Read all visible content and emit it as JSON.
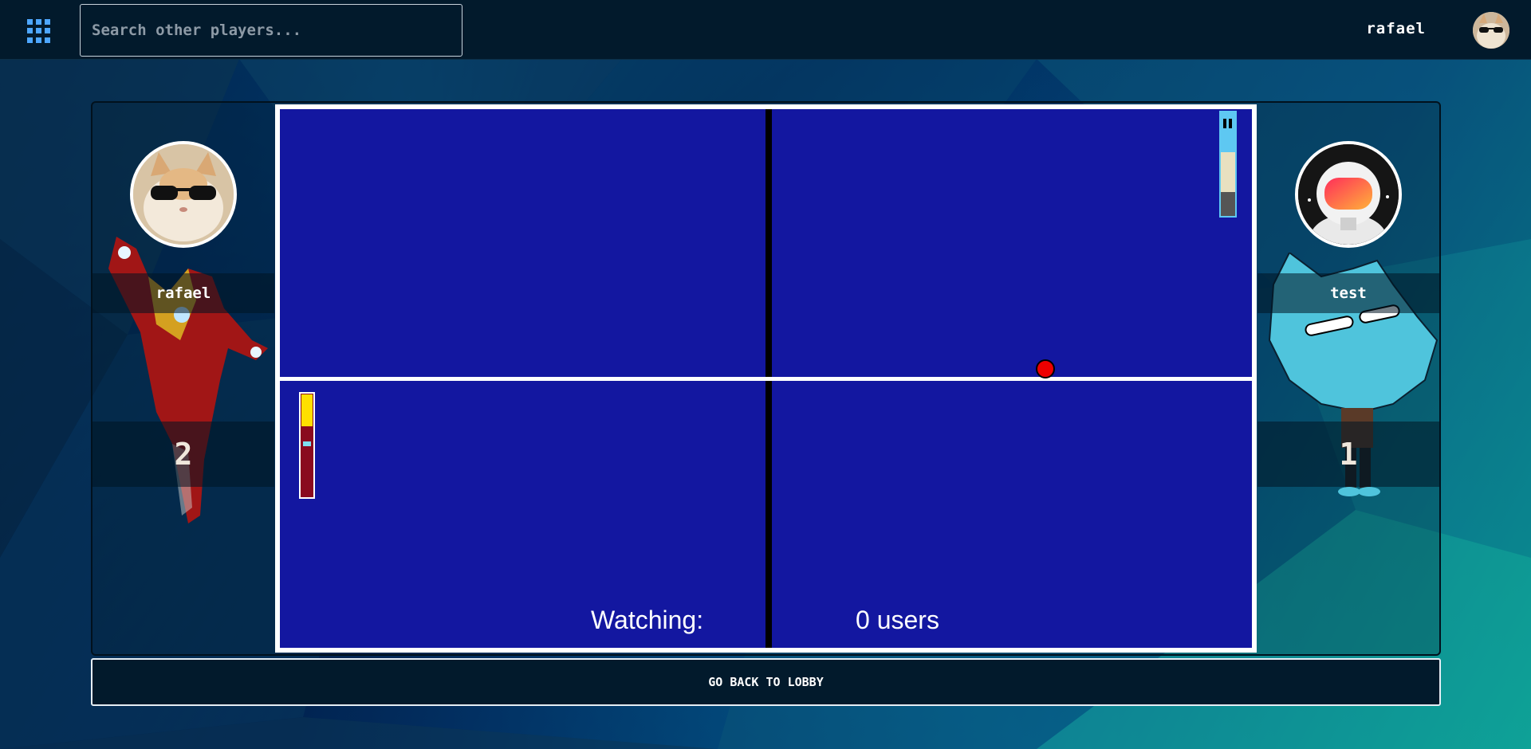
{
  "header": {
    "menu_icon": "apps-grid-icon",
    "search_placeholder": "Search other players...",
    "user_name": "rafael"
  },
  "players": {
    "left": {
      "name": "rafael",
      "score": "2"
    },
    "right": {
      "name": "test",
      "score": "1"
    }
  },
  "game": {
    "watching_label": "Watching:",
    "watching_count": "0 users"
  },
  "actions": {
    "back_label": "GO BACK TO LOBBY"
  },
  "colors": {
    "court": "#1317a0",
    "ball": "#ee0000",
    "left_paddle": "#8a0a1f",
    "right_paddle_border": "#5ec8f2"
  }
}
